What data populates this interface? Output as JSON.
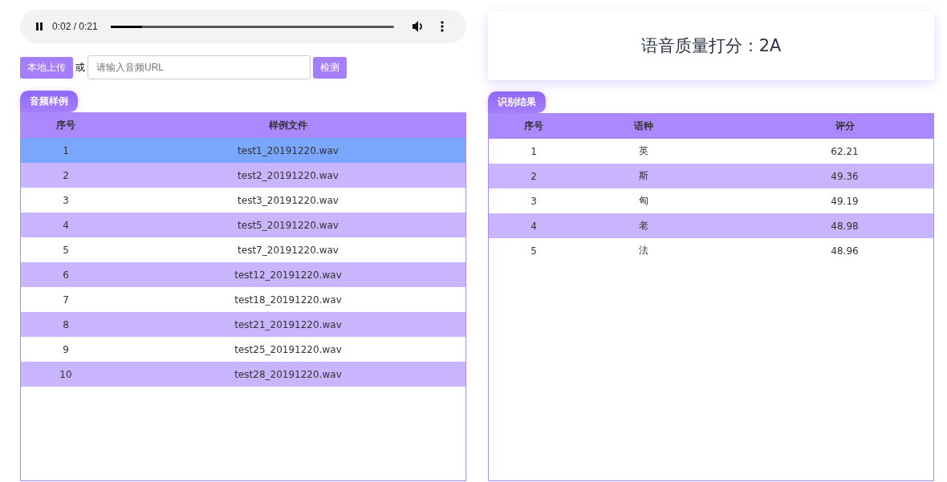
{
  "audio_player": {
    "time": "0:02 / 0:21",
    "playing": true,
    "level": 0.11
  },
  "upload": {
    "upload_button": "本地上传",
    "or_label": "或",
    "url_field": {
      "placeholder": "请输入音频URL"
    },
    "check_button": "检测"
  },
  "samples": {
    "title": "音频样例",
    "columns": [
      "序号",
      "样例文件"
    ],
    "rows": [
      {
        "index": "1",
        "file": "test1_20191220.wav",
        "selected": true
      },
      {
        "index": "2",
        "file": "test2_20191220.wav",
        "selected": false
      },
      {
        "index": "3",
        "file": "test3_20191220.wav",
        "selected": false
      },
      {
        "index": "4",
        "file": "test5_20191220.wav",
        "selected": false
      },
      {
        "index": "5",
        "file": "test7_20191220.wav",
        "selected": false
      },
      {
        "index": "6",
        "file": "test12_20191220.wav",
        "selected": false
      },
      {
        "index": "7",
        "file": "test18_20191220.wav",
        "selected": false
      },
      {
        "index": "8",
        "file": "test21_20191220.wav",
        "selected": false
      },
      {
        "index": "9",
        "file": "test25_20191220.wav",
        "selected": false
      },
      {
        "index": "10",
        "file": "test28_20191220.wav",
        "selected": false
      }
    ]
  },
  "quality_score": "语音质量打分：2A",
  "results": {
    "title": "识别结果",
    "columns": [
      "序号",
      "语种",
      "评分"
    ],
    "rows": [
      {
        "index": "1",
        "language": "英",
        "score": "62.21"
      },
      {
        "index": "2",
        "language": "斯",
        "score": "49.36"
      },
      {
        "index": "3",
        "language": "匈",
        "score": "49.19"
      },
      {
        "index": "4",
        "language": "老",
        "score": "48.98"
      },
      {
        "index": "5",
        "language": "法",
        "score": "48.96"
      }
    ]
  }
}
